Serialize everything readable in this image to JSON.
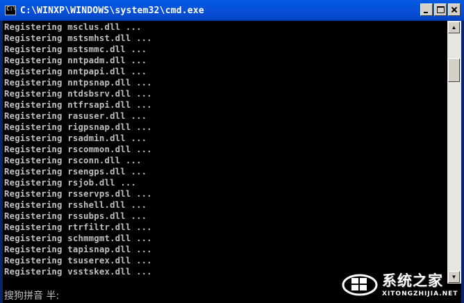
{
  "window": {
    "title": "C:\\WINXP\\WINDOWS\\system32\\cmd.exe",
    "icon": "cmd-icon",
    "icon_text": "C:\\",
    "buttons": [
      "minimize",
      "maximize",
      "close"
    ]
  },
  "console": {
    "lines": [
      "Registering msclus.dll ...",
      "Registering mstsmhst.dll ...",
      "Registering mstsmmc.dll ...",
      "Registering nntpadm.dll ...",
      "Registering nntpapi.dll ...",
      "Registering nntpsnap.dll ...",
      "Registering ntdsbsrv.dll ...",
      "Registering ntfrsapi.dll ...",
      "Registering rasuser.dll ...",
      "Registering rigpsnap.dll ...",
      "Registering rsadmin.dll ...",
      "Registering rscommon.dll ...",
      "Registering rsconn.dll ...",
      "Registering rsengps.dll ...",
      "Registering rsjob.dll ...",
      "Registering rsservps.dll ...",
      "Registering rsshell.dll ...",
      "Registering rssubps.dll ...",
      "Registering rtrfiltr.dll ...",
      "Registering schmmgmt.dll ...",
      "Registering tapisnap.dll ...",
      "Registering tsuserex.dll ...",
      "Registering vsstskex.dll ..."
    ]
  },
  "ime": {
    "text": "搜狗拼音 半:"
  },
  "watermark": {
    "cn": "系统之家",
    "en": "XITONGZHIJIA.NET"
  },
  "colors": {
    "console_bg": "#000000",
    "console_fg": "#c0c0c0",
    "titlebar": "#0a50d8"
  }
}
